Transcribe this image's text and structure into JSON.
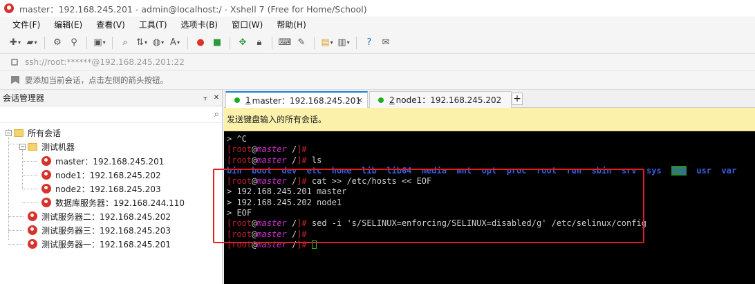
{
  "window": {
    "title": "master：192.168.245.201 - admin@localhost:/ - Xshell 7 (Free for Home/School)"
  },
  "menu": [
    "文件(F)",
    "编辑(E)",
    "查看(V)",
    "工具(T)",
    "选项卡(B)",
    "窗口(W)",
    "帮助(H)"
  ],
  "address": {
    "value": "ssh://root:******@192.168.245.201:22"
  },
  "hint": {
    "text": "要添加当前会话，点击左侧的箭头按钮。"
  },
  "session_manager": {
    "title": "会话管理器",
    "pin": "ᚁ",
    "close": "✕",
    "root": "所有会话",
    "folder": "测试机器",
    "folder_sessions": [
      "master：192.168.245.201",
      "node1：192.168.245.202",
      "node2：192.168.245.203",
      "数据库服务器：192.168.244.110"
    ],
    "sessions": [
      "测试服务器二：192.168.245.202",
      "测试服务器三：192.168.245.203",
      "测试服务器一：192.168.245.201"
    ]
  },
  "tabs": [
    {
      "num": "1",
      "label": "master：192.168.245.201",
      "active": true
    },
    {
      "num": "2",
      "label": "node1：192.168.245.202",
      "active": false
    }
  ],
  "tab_add": "+",
  "broadcast": {
    "text": "发送键盘输入的所有会话。"
  },
  "terminal": {
    "prompt_user": "root",
    "prompt_at": "@",
    "prompt_host": "master",
    "prompt_dir": " /",
    "lines": {
      "l0": "> ^C",
      "l2_cmd": " ls",
      "ls_dirs": [
        "bin",
        "boot",
        "dev",
        "etc",
        "home",
        "lib",
        "lib64",
        "media",
        "mnt",
        "opt",
        "proc",
        "root",
        "run",
        "sbin",
        "srv",
        "sys"
      ],
      "ls_tmp": "tmp",
      "ls_tail": [
        "usr",
        "var"
      ],
      "l4_cmd": " cat >> /etc/hosts << EOF",
      "l5": "> 192.168.245.201 master",
      "l6": "> 192.168.245.202 node1",
      "l7": "> EOF",
      "l8_cmd": " sed -i 's/SELINUX=enforcing/SELINUX=disabled/g' /etc/selinux/config"
    }
  }
}
